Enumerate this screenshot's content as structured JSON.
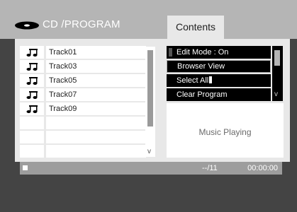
{
  "header": {
    "title": "CD /PROGRAM",
    "tab": "Contents"
  },
  "tracks": [
    "Track01",
    "Track03",
    "Track05",
    "Track07",
    "Track09"
  ],
  "track_list": {
    "scroll_indicator": "v"
  },
  "menu": {
    "items": [
      "Edit Mode   : On",
      "Browser View",
      "Select All",
      "Clear Program"
    ],
    "scroll_indicator": "v"
  },
  "status_panel": {
    "text": "Music Playing"
  },
  "status_bar": {
    "count": "--/11",
    "time": "00:00:00"
  },
  "colors": {
    "background_dark": "#444444",
    "topbar": "#b5b5b5",
    "panel": "#e8e8e8",
    "statusbar": "#9d9d9d"
  }
}
